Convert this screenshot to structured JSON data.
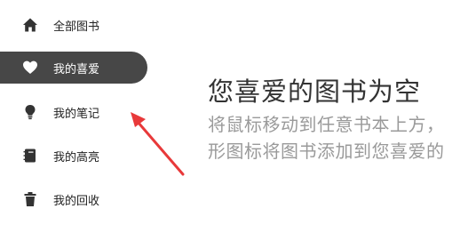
{
  "sidebar": {
    "items": [
      {
        "label": "全部图书",
        "icon": "home-icon",
        "active": false
      },
      {
        "label": "我的喜爱",
        "icon": "heart-icon",
        "active": true
      },
      {
        "label": "我的笔记",
        "icon": "lightbulb-icon",
        "active": false
      },
      {
        "label": "我的高亮",
        "icon": "notebook-icon",
        "active": false
      },
      {
        "label": "我的回收",
        "icon": "trash-icon",
        "active": false
      }
    ]
  },
  "empty_state": {
    "title": "您喜爱的图书为空",
    "description_line1": "将鼠标移动到任意书本上方，",
    "description_line2": "形图标将图书添加到您喜爱的"
  },
  "colors": {
    "active_bg": "#474747",
    "annotation_arrow": "#e8393a",
    "description_text": "#9a9a9a"
  }
}
